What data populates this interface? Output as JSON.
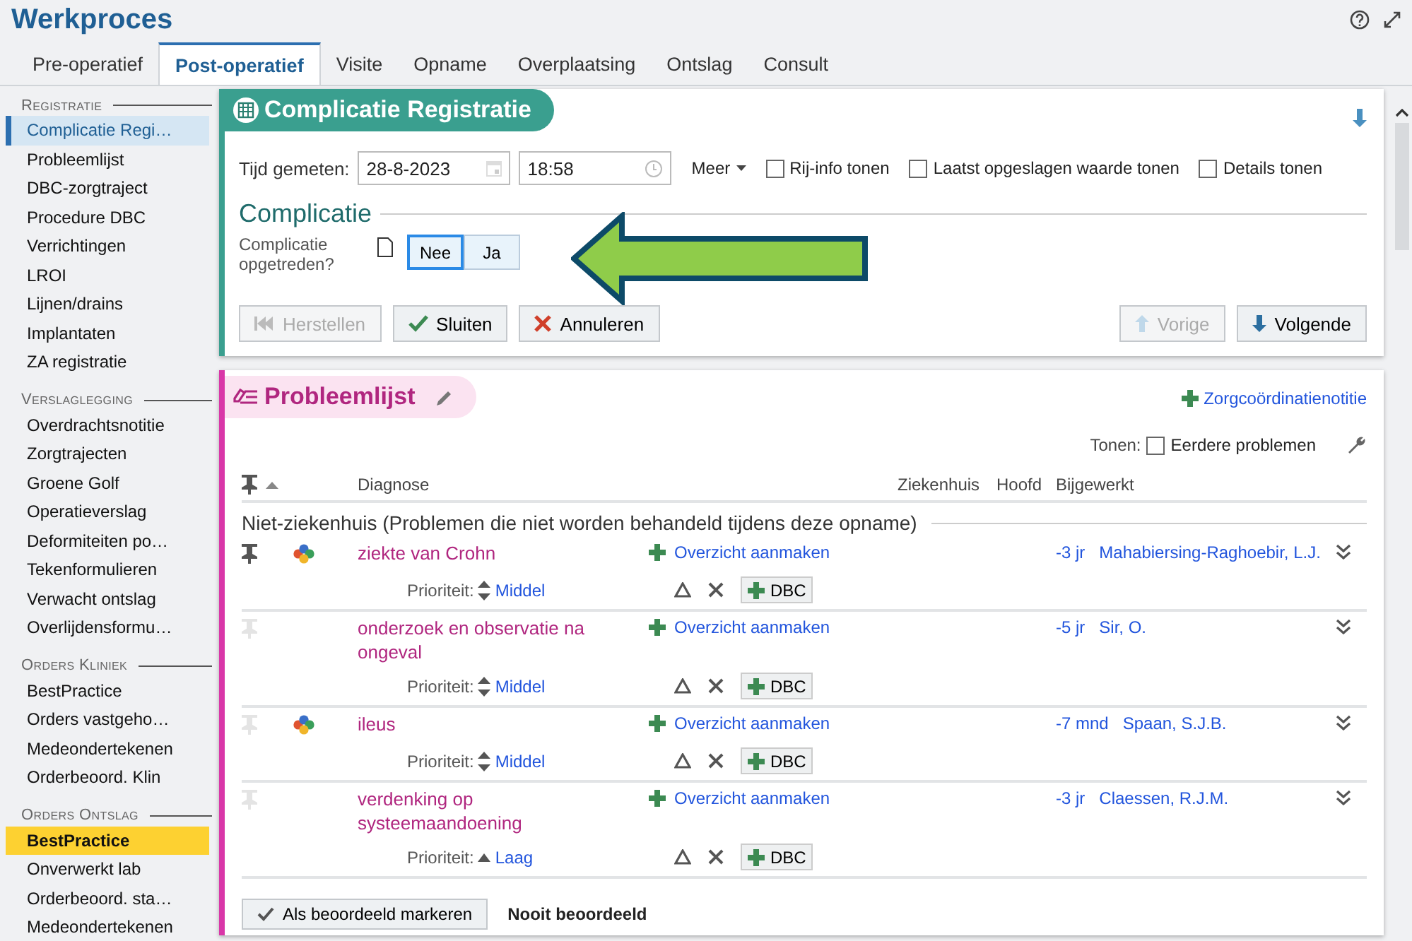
{
  "window": {
    "title": "Werkproces"
  },
  "tabs": [
    {
      "label": "Pre-operatief",
      "selected": false
    },
    {
      "label": "Post-operatief",
      "selected": true
    },
    {
      "label": "Visite",
      "selected": false
    },
    {
      "label": "Opname",
      "selected": false
    },
    {
      "label": "Overplaatsing",
      "selected": false
    },
    {
      "label": "Ontslag",
      "selected": false
    },
    {
      "label": "Consult",
      "selected": false
    }
  ],
  "sidebar": {
    "sections": [
      {
        "heading": "Registratie",
        "items": [
          {
            "label": "Complicatie Regi…",
            "selected": true,
            "highlighted": false
          },
          {
            "label": "Probleemlijst",
            "selected": false,
            "highlighted": false
          },
          {
            "label": "DBC-zorgtraject",
            "selected": false,
            "highlighted": false
          },
          {
            "label": "Procedure DBC",
            "selected": false,
            "highlighted": false
          },
          {
            "label": "Verrichtingen",
            "selected": false,
            "highlighted": false
          },
          {
            "label": "LROI",
            "selected": false,
            "highlighted": false
          },
          {
            "label": "Lijnen/drains",
            "selected": false,
            "highlighted": false
          },
          {
            "label": "Implantaten",
            "selected": false,
            "highlighted": false
          },
          {
            "label": "ZA registratie",
            "selected": false,
            "highlighted": false
          }
        ]
      },
      {
        "heading": "Verslaglegging",
        "items": [
          {
            "label": "Overdrachtsnotitie",
            "selected": false,
            "highlighted": false
          },
          {
            "label": "Zorgtrajecten",
            "selected": false,
            "highlighted": false
          },
          {
            "label": "Groene Golf",
            "selected": false,
            "highlighted": false
          },
          {
            "label": "Operatieverslag",
            "selected": false,
            "highlighted": false
          },
          {
            "label": "Deformiteiten po…",
            "selected": false,
            "highlighted": false
          },
          {
            "label": "Tekenformulieren",
            "selected": false,
            "highlighted": false
          },
          {
            "label": "Verwacht ontslag",
            "selected": false,
            "highlighted": false
          },
          {
            "label": "Overlijdensformu…",
            "selected": false,
            "highlighted": false
          }
        ]
      },
      {
        "heading": "Orders Kliniek",
        "items": [
          {
            "label": "BestPractice",
            "selected": false,
            "highlighted": false
          },
          {
            "label": "Orders vastgeho…",
            "selected": false,
            "highlighted": false
          },
          {
            "label": "Medeondertekenen",
            "selected": false,
            "highlighted": false
          },
          {
            "label": "Orderbeoord. Klin",
            "selected": false,
            "highlighted": false
          }
        ]
      },
      {
        "heading": "Orders Ontslag",
        "items": [
          {
            "label": "BestPractice",
            "selected": false,
            "highlighted": true
          },
          {
            "label": "Onverwerkt lab",
            "selected": false,
            "highlighted": false
          },
          {
            "label": "Orderbeoord. sta…",
            "selected": false,
            "highlighted": false
          },
          {
            "label": "Medeondertekenen",
            "selected": false,
            "highlighted": false
          }
        ]
      }
    ]
  },
  "complication_form": {
    "title": "Complicatie Registratie",
    "time_label": "Tijd gemeten:",
    "date": "28-8-2023",
    "time": "18:58",
    "more": "Meer",
    "options": [
      {
        "label": "Rij-info tonen",
        "checked": false
      },
      {
        "label": "Laatst opgeslagen waarde tonen",
        "checked": false
      },
      {
        "label": "Details tonen",
        "checked": false
      }
    ],
    "section": "Complicatie",
    "question": "Complicatie opgetreden?",
    "answers": [
      {
        "label": "Nee",
        "selected": true
      },
      {
        "label": "Ja",
        "selected": false
      }
    ],
    "buttons": [
      {
        "label": "Herstellen",
        "kind": "restore",
        "disabled": true
      },
      {
        "label": "Sluiten",
        "kind": "close",
        "disabled": false
      },
      {
        "label": "Annuleren",
        "kind": "cancel",
        "disabled": false
      }
    ],
    "nav_buttons": [
      {
        "label": "Vorige",
        "kind": "up",
        "disabled": true
      },
      {
        "label": "Volgende",
        "kind": "down",
        "disabled": false
      }
    ]
  },
  "problem_list": {
    "title": "Probleemlijst",
    "add_note": "Zorgcoördinatienotitie",
    "show_label": "Tonen:",
    "show_options": [
      {
        "label": "Eerdere problemen",
        "checked": false
      }
    ],
    "columns": [
      "Diagnose",
      "Ziekenhuis",
      "Hoofd",
      "Bijgewerkt"
    ],
    "group": "Niet-ziekenhuis (Problemen die niet worden behandeld tijdens deze opname)",
    "rows": [
      {
        "diagnosis": "ziekte van Crohn",
        "pinned": true,
        "shared": true,
        "overview": "Overzicht aanmaken",
        "priority_label": "Prioriteit:",
        "priority": "Middel",
        "kind": "both",
        "dbc": "DBC",
        "updated": "-3 jr",
        "by": "Mahabiersing-Raghoebir, L.J."
      },
      {
        "diagnosis": "onderzoek en observatie na ongeval",
        "pinned": false,
        "shared": false,
        "overview": "Overzicht aanmaken",
        "priority_label": "Prioriteit:",
        "priority": "Middel",
        "kind": "both",
        "dbc": "DBC",
        "updated": "-5 jr",
        "by": "Sir, O."
      },
      {
        "diagnosis": "ileus",
        "pinned": false,
        "shared": true,
        "overview": "Overzicht aanmaken",
        "priority_label": "Prioriteit:",
        "priority": "Middel",
        "kind": "both",
        "dbc": "DBC",
        "updated": "-7 mnd",
        "by": "Spaan, S.J.B."
      },
      {
        "diagnosis": "verdenking op systeemaandoening",
        "pinned": false,
        "shared": false,
        "overview": "Overzicht aanmaken",
        "priority_label": "Prioriteit:",
        "priority": "Laag",
        "kind": "up",
        "dbc": "DBC",
        "updated": "-3 jr",
        "by": "Claessen, R.J.M."
      }
    ],
    "mark_button": "Als beoordeeld markeren",
    "review_status": "Nooit beoordeeld"
  }
}
